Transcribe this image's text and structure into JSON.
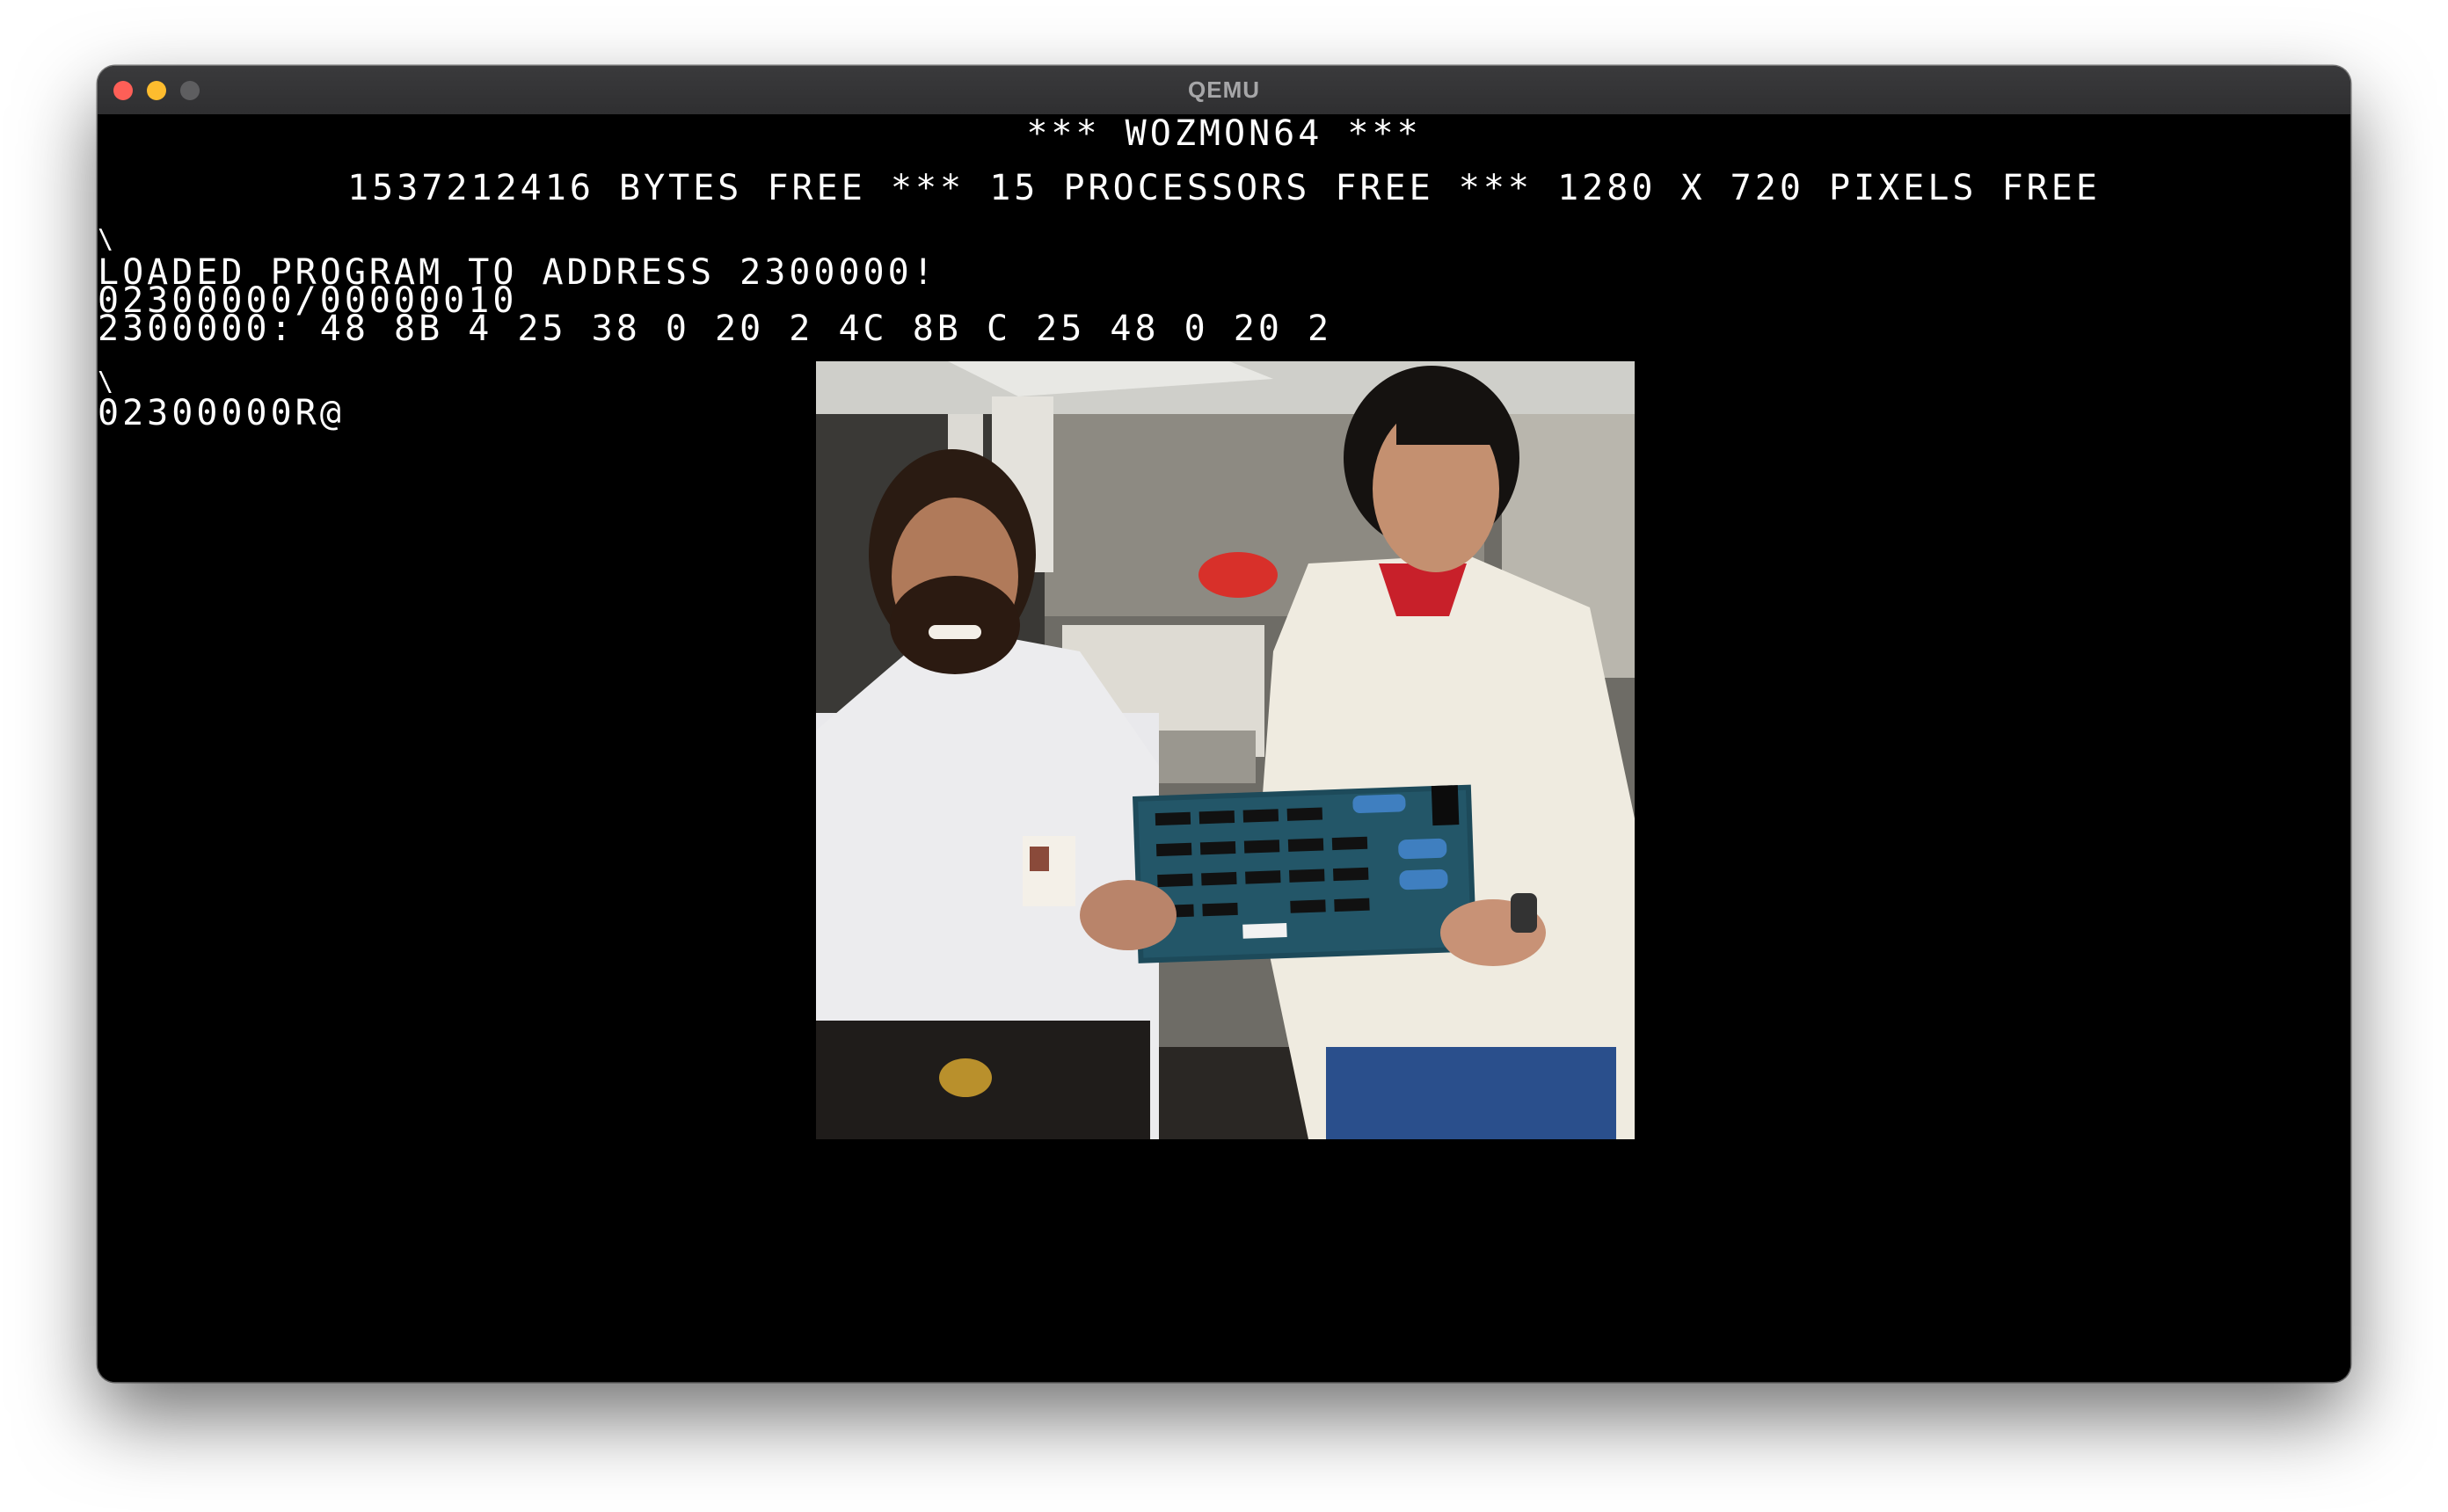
{
  "window": {
    "title": "QEMU",
    "controls": {
      "close_color": "#fe5f57",
      "minimize_color": "#febc2e",
      "zoom_color": "#5e5e60"
    }
  },
  "screen": {
    "background": "#000000",
    "foreground": "#ffffff",
    "banner": "*** WOZMON64 ***",
    "free_line": "1537212416 BYTES FREE *** 15 PROCESSORS FREE *** 1280 X 720 PIXELS FREE",
    "prompt_1": "\\",
    "loaded_line": "LOADED PROGRAM TO ADDRESS 2300000!",
    "range_line": "02300000/00000010",
    "dump_line": "2300000: 48 8B 4 25 38 0 20 2 4C 8B C 25 48 0 20 2",
    "prompt_2": "\\",
    "command_line": "02300000R@"
  },
  "image": {
    "icon": "photo-two-men-holding-circuit-board"
  }
}
